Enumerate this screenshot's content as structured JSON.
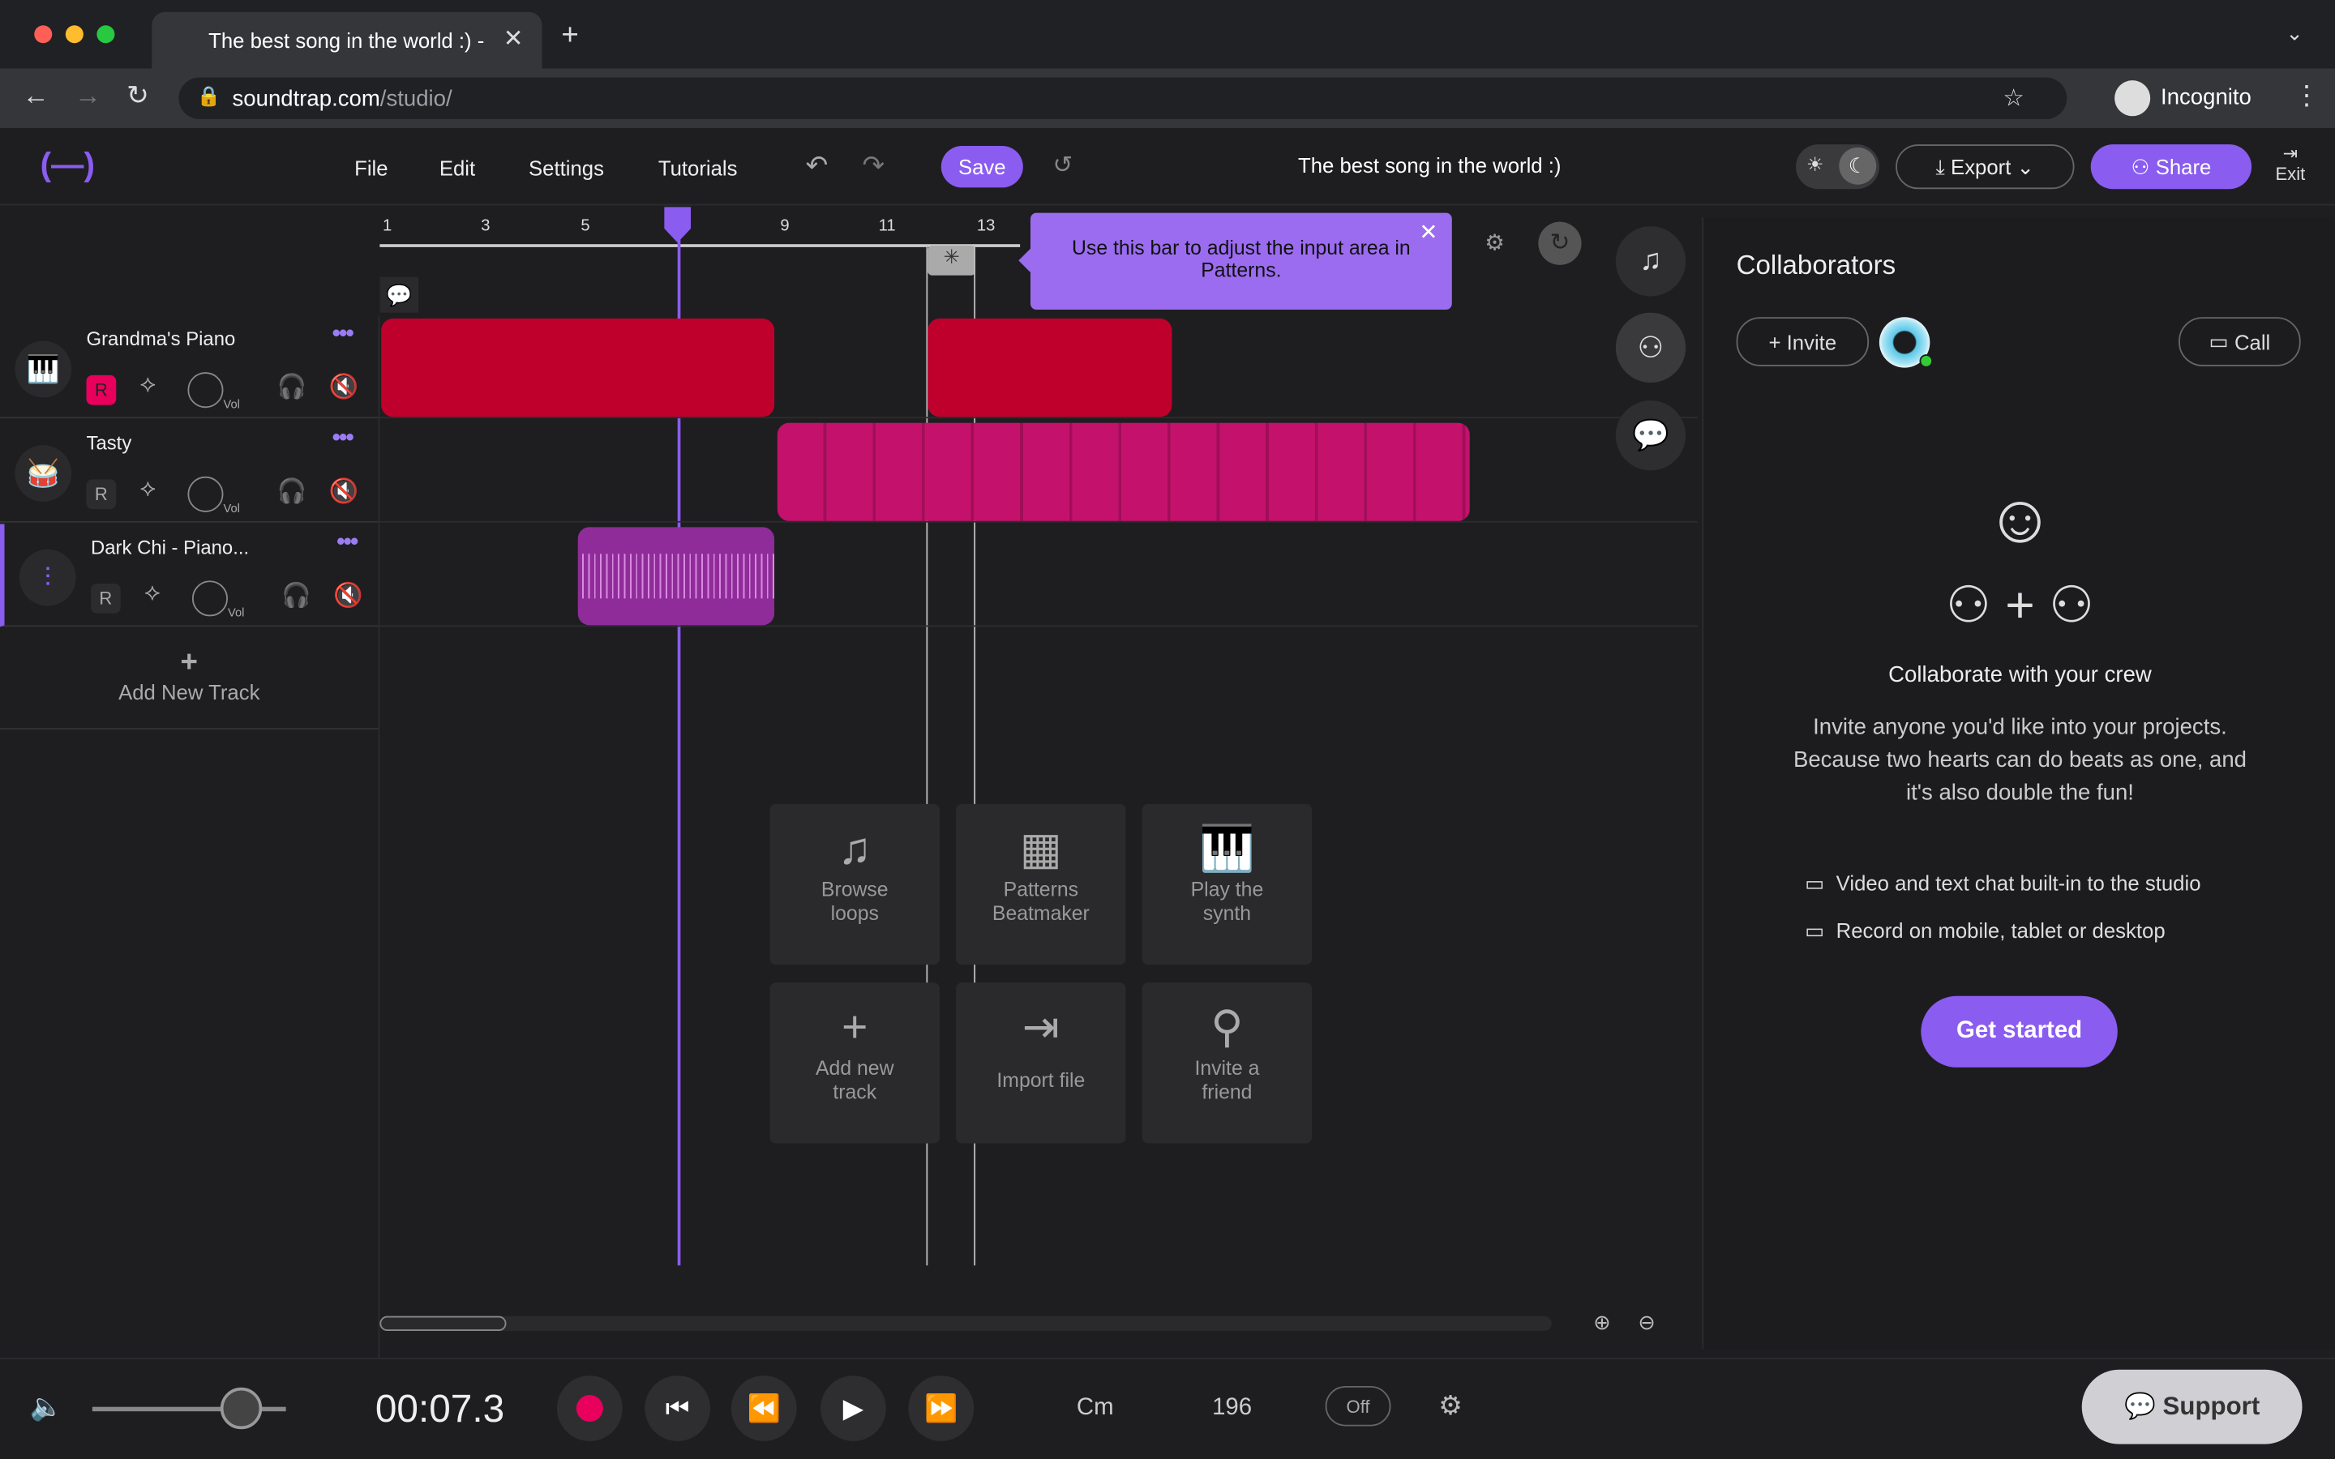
{
  "browser": {
    "tab_title": "The best song in the world :) -",
    "url_host": "soundtrap.com",
    "url_path": "/studio/",
    "profile": "Incognito"
  },
  "menu": {
    "file": "File",
    "edit": "Edit",
    "settings": "Settings",
    "tutorials": "Tutorials",
    "save": "Save"
  },
  "project_title": "The best song in the world :)",
  "header": {
    "export": "Export",
    "share": "Share",
    "exit": "Exit"
  },
  "ruler": {
    "ticks": [
      "1",
      "3",
      "5",
      "9",
      "11",
      "13"
    ]
  },
  "tooltip": "Use this bar to adjust the input area in Patterns.",
  "tracks": [
    {
      "name": "Grandma's Piano",
      "record": "R",
      "record_active": true,
      "vol_label": "Vol",
      "icon": "piano-icon"
    },
    {
      "name": "Tasty",
      "record": "R",
      "record_active": false,
      "vol_label": "Vol",
      "icon": "drum-icon"
    },
    {
      "name": "Dark Chi - Piano...",
      "record": "R",
      "record_active": false,
      "vol_label": "Vol",
      "icon": "waveform-icon"
    }
  ],
  "add_track": "Add New Track",
  "cards": [
    {
      "l1": "Browse",
      "l2": "loops"
    },
    {
      "l1": "Patterns",
      "l2": "Beatmaker"
    },
    {
      "l1": "Play the",
      "l2": "synth"
    },
    {
      "l1": "Add new",
      "l2": "track"
    },
    {
      "l1": "Import file",
      "l2": ""
    },
    {
      "l1": "Invite a",
      "l2": "friend"
    }
  ],
  "collab": {
    "title": "Collaborators",
    "invite": "Invite",
    "call": "Call",
    "heading": "Collaborate with your crew",
    "body": "Invite anyone you'd like into your projects. Because two hearts can do beats as one, and it's also double the fun!",
    "feature1": "Video and text chat built-in to the studio",
    "feature2": "Record on mobile, tablet or desktop",
    "cta": "Get started"
  },
  "transport": {
    "time": "00:07.3",
    "key": "Cm",
    "tempo": "196",
    "metronome": "Off",
    "support": "Support",
    "volume_level": 0.8
  },
  "colors": {
    "accent": "#8a5cf0",
    "piano_clip": "#c0002c",
    "drum_clip": "#c4126c",
    "audio_clip": "#902c9a"
  }
}
